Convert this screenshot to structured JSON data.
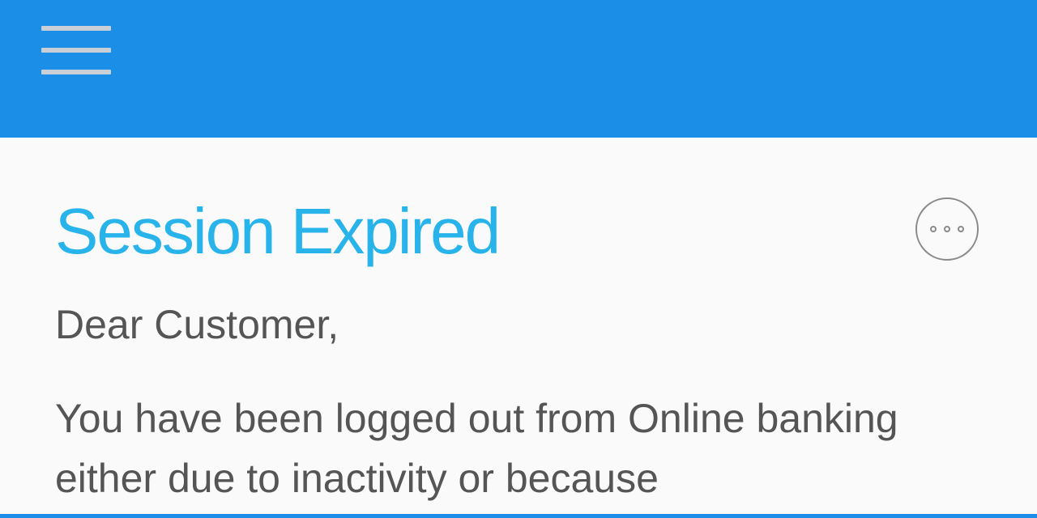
{
  "header": {
    "menu_icon": "hamburger-menu-icon",
    "background_color": "#1b8fe8"
  },
  "main": {
    "title": "Session Expired",
    "title_color": "#28b4ea",
    "more_icon": "more-options-icon",
    "greeting": "Dear Customer,",
    "message": "You have been logged out from Online banking either due to inactivity or because"
  }
}
